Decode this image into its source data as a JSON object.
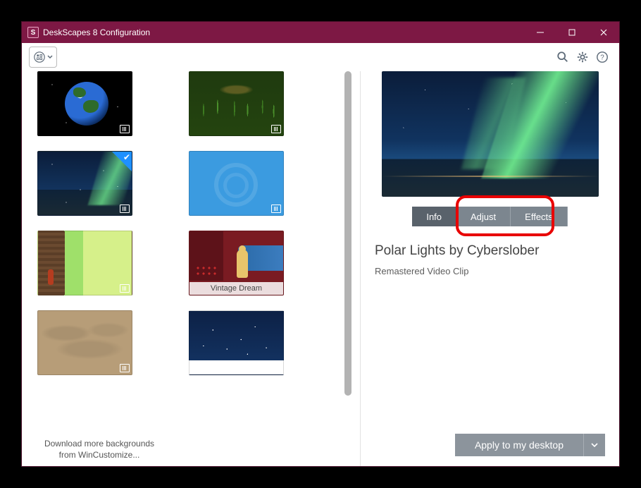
{
  "window": {
    "title": "DeskScapes 8 Configuration"
  },
  "toolbar": {
    "view_button_name": "view-options",
    "search_name": "search",
    "settings_name": "settings",
    "help_name": "help"
  },
  "thumbnails": [
    {
      "name": "earth",
      "label": "",
      "video": true,
      "selected": false
    },
    {
      "name": "forest",
      "label": "",
      "video": true,
      "selected": false
    },
    {
      "name": "polar-lights",
      "label": "",
      "video": true,
      "selected": true
    },
    {
      "name": "blue-swirl",
      "label": "",
      "video": true,
      "selected": false
    },
    {
      "name": "tree-bark",
      "label": "",
      "video": true,
      "selected": false
    },
    {
      "name": "vintage-dream",
      "label": "Vintage Dream",
      "video": false,
      "selected": false
    },
    {
      "name": "sand",
      "label": "",
      "video": true,
      "selected": false
    },
    {
      "name": "snow-night",
      "label": "",
      "video": true,
      "selected": false
    }
  ],
  "download_more": "Download more backgrounds from WinCustomize...",
  "tabs": {
    "info": "Info",
    "adjust": "Adjust",
    "effects": "Effects"
  },
  "detail": {
    "title": "Polar Lights by Cyberslober",
    "subtitle": "Remastered Video Clip"
  },
  "apply_button": "Apply to my desktop",
  "highlight": {
    "target": "adjust-effects-tabs"
  }
}
